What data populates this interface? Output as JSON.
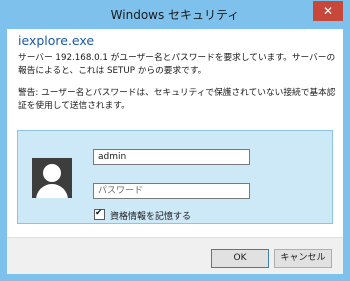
{
  "window": {
    "title": "Windows セキュリティ",
    "close_glyph": "✕"
  },
  "app_name": "iexplore.exe",
  "message_1": "サーバー 192.168.0.1 がユーザー名とパスワードを要求しています。サーバーの報告によると、これは SETUP からの要求です。",
  "message_2": "警告: ユーザー名とパスワードは、セキュリティで保護されていない接続で基本認証を使用して送信されます。",
  "credentials": {
    "username_value": "admin",
    "password_placeholder": "パスワード",
    "remember_label": "資格情報を記憶する",
    "remember_checked": true,
    "checkmark": "✔"
  },
  "buttons": {
    "ok": "OK",
    "cancel": "キャンセル"
  }
}
